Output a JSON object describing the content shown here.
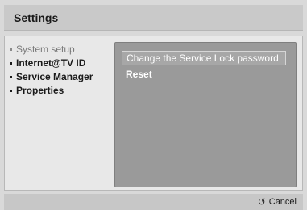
{
  "header": {
    "title": "Settings"
  },
  "menu": {
    "items": [
      {
        "label": "System setup",
        "state": "dimmed"
      },
      {
        "label": "Internet@TV ID"
      },
      {
        "label": "Service Manager"
      },
      {
        "label": "Properties"
      }
    ]
  },
  "panel": {
    "options": [
      {
        "label": "Change the Service Lock password",
        "selected": true
      },
      {
        "label": "Reset"
      }
    ]
  },
  "footer": {
    "cancel_icon": "↺",
    "cancel_label": "Cancel"
  },
  "colors": {
    "background": "#d9d9d9",
    "panel": "#9a9a9a",
    "text_dark": "#1a1a1a",
    "text_light": "#ffffff",
    "dimmed": "#7a7a7a"
  }
}
